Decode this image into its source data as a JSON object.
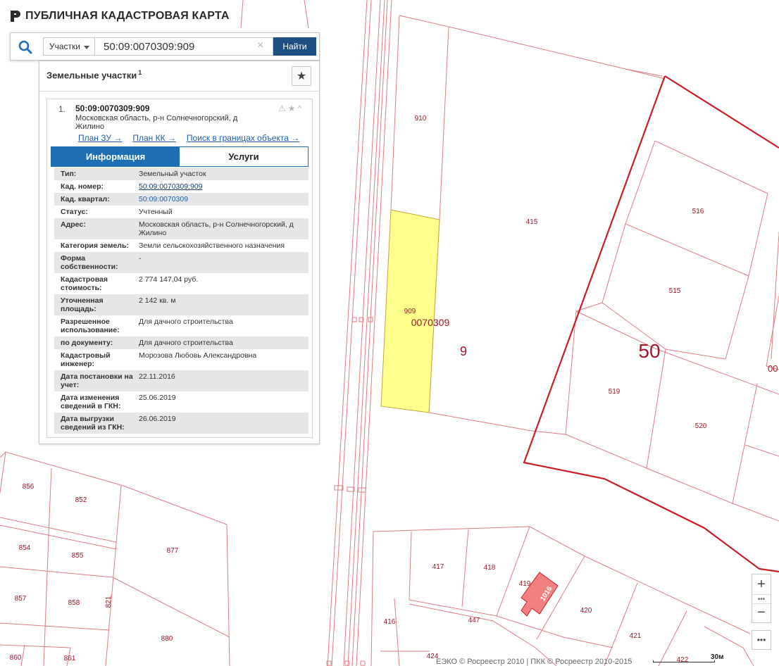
{
  "header": {
    "title": "ПУБЛИЧНАЯ КАДАСТРОВАЯ КАРТА",
    "logo_icon": "pkk-logo-icon"
  },
  "search": {
    "type_label": "Участки",
    "query": "50:09:0070309:909",
    "clear_symbol": "×",
    "find_label": "Найти"
  },
  "panel": {
    "title": "Земельные участки",
    "count": "1",
    "fav_symbol": "★",
    "result": {
      "index": "1.",
      "number": "50:09:0070309:909",
      "address": "Московская область, р-н Солнечногорский, д Жилино",
      "links": [
        "План ЗУ →",
        "План КК →",
        "Поиск в границах объекта →"
      ],
      "tabs": {
        "info": "Информация",
        "services": "Услуги"
      },
      "rows": [
        {
          "k": "Тип:",
          "v": "Земельный участок"
        },
        {
          "k": "Кад. номер:",
          "v": "50:09:0070309:909"
        },
        {
          "k": "Кад. квартал:",
          "v": "50:09:0070309"
        },
        {
          "k": "Статус:",
          "v": "Учтенный"
        },
        {
          "k": "Адрес:",
          "v": "Московская область, р-н Солнечногорский, д Жилино"
        },
        {
          "k": "Категория земель:",
          "v": "Земли сельскохозяйственного назначения"
        },
        {
          "k": "Форма собственности:",
          "v": "-"
        },
        {
          "k": "Кадастровая стоимость:",
          "v": "2 774 147,04 руб."
        },
        {
          "k": "Уточненная площадь:",
          "v": "2 142 кв. м"
        },
        {
          "k": "Разрешенное использование:",
          "v": "Для дачного строительства"
        },
        {
          "k": "по документу:",
          "v": "Для дачного строительства"
        },
        {
          "k": "Кадастровый инженер:",
          "v": "Морозова Любовь Александровна"
        },
        {
          "k": "Дата постановки на учет:",
          "v": "22.11.2016"
        },
        {
          "k": "Дата изменения сведений в ГКН:",
          "v": "25.06.2019"
        },
        {
          "k": "Дата выгрузки сведений из ГКН:",
          "v": "26.06.2019"
        }
      ]
    }
  },
  "map": {
    "labels": {
      "p910": "910",
      "p415": "415",
      "p516": "516",
      "p515": "515",
      "p909": "909",
      "quarter": "0070309",
      "q9": "9",
      "q50": "50",
      "q00": "00",
      "p519": "519",
      "p520": "520",
      "p856": "856",
      "p852": "852",
      "p854": "854",
      "p855": "855",
      "p877": "877",
      "p857": "857",
      "p858": "858",
      "p821": "821",
      "p880": "880",
      "p860": "860",
      "p861": "861",
      "p417": "417",
      "p418": "418",
      "p419": "419",
      "p1016": "1016",
      "p420": "420",
      "p416": "416",
      "p447": "447",
      "p421": "421",
      "p424": "424",
      "p422": "422"
    }
  },
  "controls": {
    "zoom_in": "+",
    "zoom_out": "−",
    "dots": "•••",
    "more": "•••"
  },
  "footer": {
    "copyright": "ЕЭКО © Росреестр 2010 | ПКК © Росреестр 2010-2015",
    "scale": "30м"
  },
  "colors": {
    "boundary": "#e8a0a8",
    "boundary_dark": "#c81e26",
    "label": "#a0182a",
    "selected_fill": "#ffff8c",
    "accent_blue": "#1f6fb5",
    "button_blue": "#1d4f83",
    "building": "#f28080"
  }
}
